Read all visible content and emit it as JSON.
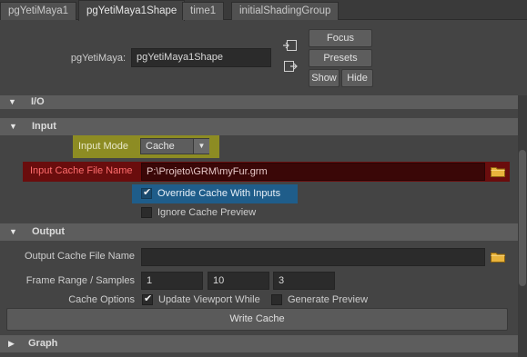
{
  "tabs": [
    {
      "label": "pgYetiMaya1",
      "active": false
    },
    {
      "label": "pgYetiMaya1Shape",
      "active": true
    },
    {
      "label": "time1",
      "active": false
    },
    {
      "label": "initialShadingGroup",
      "active": false
    }
  ],
  "node": {
    "label": "pgYetiMaya:",
    "value": "pgYetiMaya1Shape",
    "focus_label": "Focus",
    "presets_label": "Presets",
    "show_label": "Show",
    "hide_label": "Hide"
  },
  "sections": {
    "io": "I/O",
    "input": "Input",
    "output": "Output",
    "graph": "Graph"
  },
  "input": {
    "mode_label": "Input Mode",
    "mode_value": "Cache",
    "cache_file_label": "Input Cache File Name",
    "cache_file_value": "P:\\Projeto\\GRM\\myFur.grm",
    "override_label": "Override Cache With Inputs",
    "override_checked": true,
    "ignore_preview_label": "Ignore Cache Preview",
    "ignore_preview_checked": false
  },
  "output": {
    "cache_file_label": "Output Cache File Name",
    "cache_file_value": "",
    "frame_range_label": "Frame Range / Samples",
    "frame_start": "1",
    "frame_end": "10",
    "samples": "3",
    "cache_options_label": "Cache Options",
    "update_viewport_label": "Update Viewport While",
    "update_viewport_checked": true,
    "generate_preview_label": "Generate Preview",
    "generate_preview_checked": false,
    "write_cache_label": "Write Cache"
  },
  "colors": {
    "highlight_yellow": "#8d8c23",
    "highlight_red": "#6a0d0d",
    "highlight_blue": "#1f5d8a",
    "folder": "#e9b43c"
  }
}
